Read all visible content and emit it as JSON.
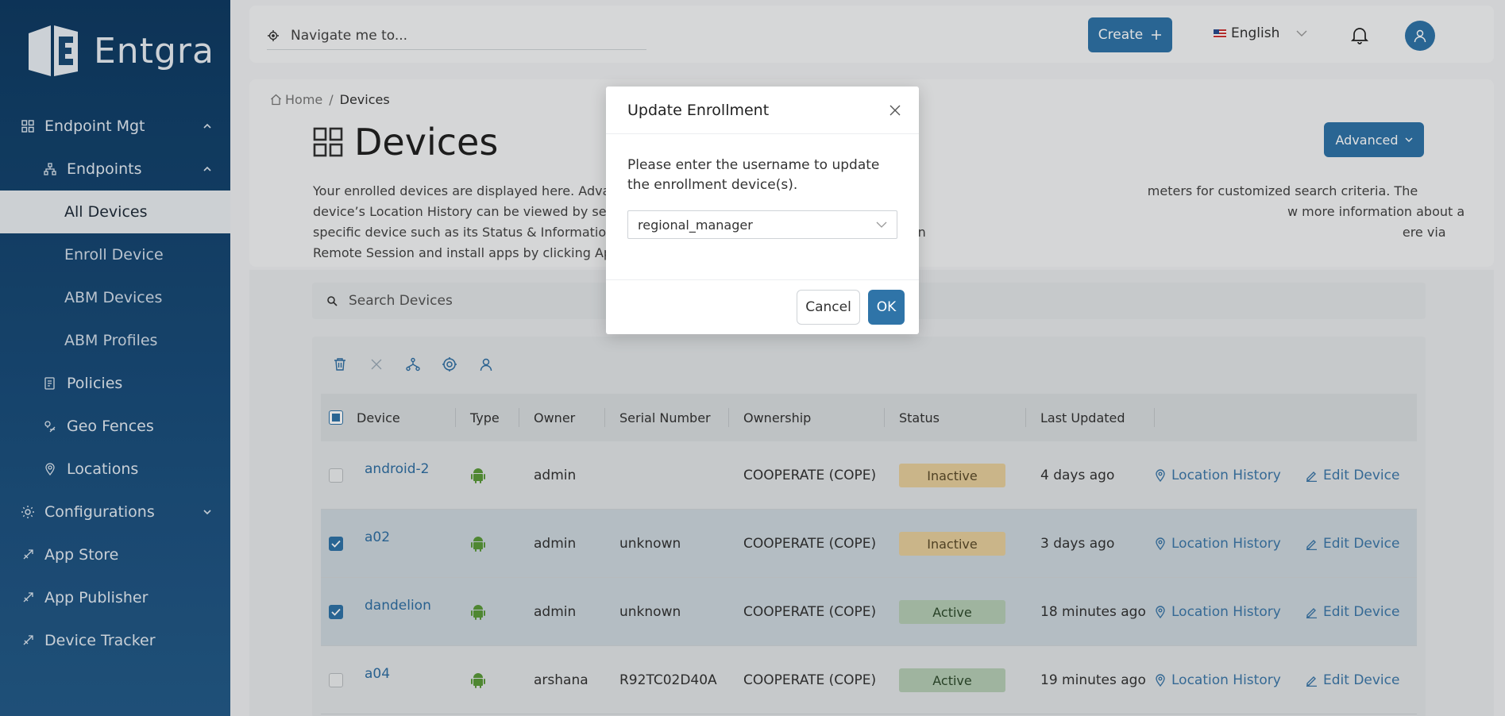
{
  "app": {
    "brand": "Entgra"
  },
  "sidebar": {
    "items": [
      {
        "label": "Endpoint Mgt",
        "icon": "grid-icon"
      },
      {
        "label": "Endpoints",
        "icon": "hierarchy-icon"
      },
      {
        "label": "All Devices"
      },
      {
        "label": "Enroll Device"
      },
      {
        "label": "ABM Devices"
      },
      {
        "label": "ABM Profiles"
      },
      {
        "label": "Policies",
        "icon": "policy-icon"
      },
      {
        "label": "Geo Fences",
        "icon": "geofence-icon"
      },
      {
        "label": "Locations",
        "icon": "location-pin-icon"
      },
      {
        "label": "Configurations",
        "icon": "gear-icon"
      },
      {
        "label": "App Store",
        "icon": "rocket-icon"
      },
      {
        "label": "App Publisher",
        "icon": "rocket-icon"
      },
      {
        "label": "Device Tracker",
        "icon": "rocket-icon"
      }
    ]
  },
  "topbar": {
    "search_placeholder": "Navigate me to...",
    "create_label": "Create",
    "language": "English"
  },
  "header": {
    "breadcrumb_home": "Home",
    "breadcrumb_sep": "/",
    "breadcrumb_current": "Devices",
    "title": "Devices",
    "advanced_label": "Advanced",
    "description": "Your enrolled devices are displayed here. Advan                                                                                                                                   meters for customized search criteria. The device’s Location History can be viewed by setting a date range, the period for w                                                                                                                 w more information about a specific device such as its Status & Information, Operations Logand Policy Compliance by clickin                                                                                                                      ere via Remote Session and install apps by clicking Apps."
  },
  "search": {
    "placeholder": "Search Devices"
  },
  "table": {
    "columns": [
      "Device",
      "Type",
      "Owner",
      "Serial Number",
      "Ownership",
      "Status",
      "Last Updated"
    ],
    "rows": [
      {
        "device": "android-2",
        "owner": "admin",
        "serial": "",
        "ownership": "COOPERATE (COPE)",
        "status": "Inactive",
        "updated": "4 days ago",
        "loc": "Location History",
        "edit": "Edit Device"
      },
      {
        "device": "a02",
        "owner": "admin",
        "serial": "unknown",
        "ownership": "COOPERATE (COPE)",
        "status": "Inactive",
        "updated": "3 days ago",
        "loc": "Location History",
        "edit": "Edit Device"
      },
      {
        "device": "dandelion",
        "owner": "admin",
        "serial": "unknown",
        "ownership": "COOPERATE (COPE)",
        "status": "Active",
        "updated": "18 minutes ago",
        "loc": "Location History",
        "edit": "Edit Device"
      },
      {
        "device": "a04",
        "owner": "arshana",
        "serial": "R92TC02D40A",
        "ownership": "COOPERATE (COPE)",
        "status": "Active",
        "updated": "19 minutes ago",
        "loc": "Location History",
        "edit": "Edit Device"
      }
    ]
  },
  "modal": {
    "title": "Update Enrollment",
    "message": "Please enter the username to update the enrollment device(s).",
    "selected_user": "regional_manager",
    "cancel_label": "Cancel",
    "ok_label": "OK"
  },
  "colors": {
    "primary": "#2f74a8",
    "sidebar": "#1b4f7d",
    "active_status": "#b6cdb5",
    "inactive_status": "#e6cf9d",
    "android": "#5a9a3a"
  }
}
